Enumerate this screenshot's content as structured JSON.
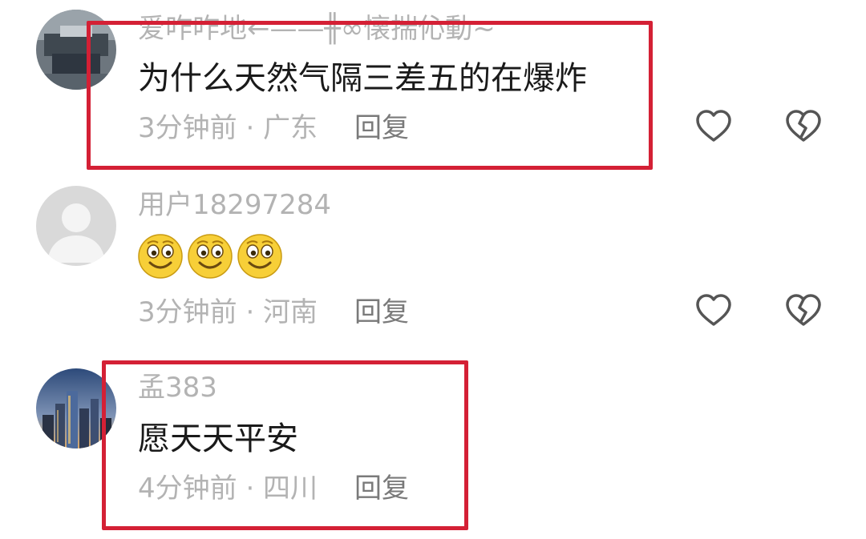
{
  "comments": [
    {
      "username": "爱咋咋地←——╫∞懐揣伈動~",
      "content": "为什么天然气隔三差五的在爆炸",
      "time_location": "3分钟前 · 广东",
      "reply_label": "回复"
    },
    {
      "username": "用户18297284",
      "content": "",
      "emoji_count": 3,
      "time_location": "3分钟前 · 河南",
      "reply_label": "回复"
    },
    {
      "username": "孟383",
      "content": "愿天天平安",
      "time_location": "4分钟前 · 四川",
      "reply_label": "回复"
    }
  ],
  "icons": {
    "like": "heart-outline",
    "dislike": "broken-heart-outline",
    "emoji": "smiling-face"
  },
  "colors": {
    "highlight_border": "#d42035",
    "meta_text": "#b3b3b3",
    "content_text": "#1a1a1a"
  }
}
